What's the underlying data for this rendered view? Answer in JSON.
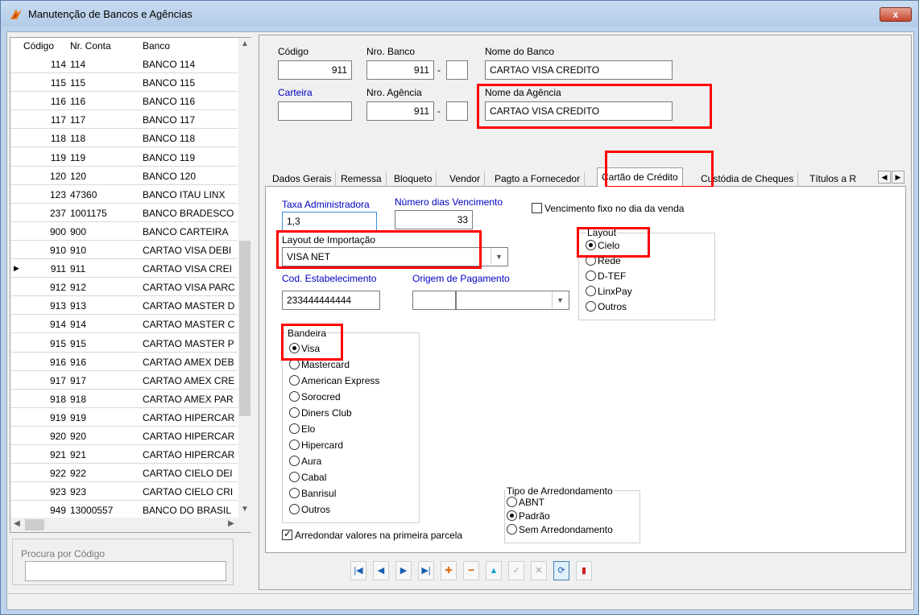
{
  "window": {
    "title": "Manutenção de Bancos e Agências",
    "close_label": "x"
  },
  "grid": {
    "headers": [
      "Código",
      "Nr. Conta",
      "Banco"
    ],
    "current_marker": "▶",
    "rows": [
      {
        "codigo": "114",
        "conta": "114",
        "banco": "BANCO 114"
      },
      {
        "codigo": "115",
        "conta": "115",
        "banco": "BANCO 115"
      },
      {
        "codigo": "116",
        "conta": "116",
        "banco": "BANCO 116"
      },
      {
        "codigo": "117",
        "conta": "117",
        "banco": "BANCO 117"
      },
      {
        "codigo": "118",
        "conta": "118",
        "banco": "BANCO 118"
      },
      {
        "codigo": "119",
        "conta": "119",
        "banco": "BANCO 119"
      },
      {
        "codigo": "120",
        "conta": "120",
        "banco": "BANCO 120"
      },
      {
        "codigo": "123",
        "conta": "47360",
        "banco": "BANCO ITAU LINX"
      },
      {
        "codigo": "237",
        "conta": "1001175",
        "banco": "BANCO BRADESCO"
      },
      {
        "codigo": "900",
        "conta": "900",
        "banco": "BANCO CARTEIRA"
      },
      {
        "codigo": "910",
        "conta": "910",
        "banco": "CARTAO VISA DEBI"
      },
      {
        "codigo": "911",
        "conta": "911",
        "banco": "CARTAO VISA CREI"
      },
      {
        "codigo": "912",
        "conta": "912",
        "banco": "CARTAO VISA PARC"
      },
      {
        "codigo": "913",
        "conta": "913",
        "banco": "CARTAO MASTER D"
      },
      {
        "codigo": "914",
        "conta": "914",
        "banco": "CARTAO MASTER C"
      },
      {
        "codigo": "915",
        "conta": "915",
        "banco": "CARTAO MASTER P"
      },
      {
        "codigo": "916",
        "conta": "916",
        "banco": "CARTAO AMEX DEB"
      },
      {
        "codigo": "917",
        "conta": "917",
        "banco": "CARTAO AMEX CRE"
      },
      {
        "codigo": "918",
        "conta": "918",
        "banco": "CARTAO AMEX PAR"
      },
      {
        "codigo": "919",
        "conta": "919",
        "banco": "CARTAO HIPERCAR"
      },
      {
        "codigo": "920",
        "conta": "920",
        "banco": "CARTAO HIPERCAR"
      },
      {
        "codigo": "921",
        "conta": "921",
        "banco": "CARTAO HIPERCAR"
      },
      {
        "codigo": "922",
        "conta": "922",
        "banco": "CARTAO CIELO DEI"
      },
      {
        "codigo": "923",
        "conta": "923",
        "banco": "CARTAO CIELO CRI"
      },
      {
        "codigo": "949",
        "conta": "13000557",
        "banco": "BANCO DO BRASIL"
      }
    ]
  },
  "search": {
    "label": "Procura por Código",
    "value": ""
  },
  "form": {
    "codigo_label": "Código",
    "codigo_value": "911",
    "nro_banco_label": "Nro. Banco",
    "nro_banco_value": "911",
    "nro_banco_dv": "",
    "nome_banco_label": "Nome do Banco",
    "nome_banco_value": "CARTAO VISA CREDITO",
    "carteira_label": "Carteira",
    "carteira_value": "",
    "nro_agencia_label": "Nro. Agência",
    "nro_agencia_value": "911",
    "nro_agencia_dv": "",
    "nome_agencia_label": "Nome da Agência",
    "nome_agencia_value": "CARTAO VISA CREDITO",
    "dash": "-"
  },
  "tabs": [
    "Dados Gerais",
    "Remessa",
    "Bloqueto",
    "Vendor",
    "Pagto a Fornecedor",
    "Cartão de Crédito",
    "Custódia de Cheques",
    "Títulos a R"
  ],
  "active_tab": "Cartão de Crédito",
  "cartao": {
    "taxa_label": "Taxa Administradora",
    "taxa_value": "1,3",
    "dias_label": "Número dias Vencimento",
    "dias_value": "33",
    "venc_fixo_label": "Vencimento fixo no dia da venda",
    "venc_fixo_checked": false,
    "layout_importacao_label": "Layout de Importação",
    "layout_importacao_value": "VISA NET",
    "cod_estab_label": "Cod. Estabelecimento",
    "cod_estab_value": "233444444444",
    "origem_label": "Origem de Pagamento",
    "origem_value": "",
    "layout_group": {
      "title": "Layout",
      "options": [
        "Cielo",
        "Rede",
        "D-TEF",
        "LinxPay",
        "Outros"
      ],
      "selected": "Cielo"
    },
    "bandeira_group": {
      "title": "Bandeira",
      "options": [
        "Visa",
        "Mastercard",
        "American Express",
        "Sorocred",
        "Diners Club",
        "Elo",
        "Hipercard",
        "Aura",
        "Cabal",
        "Banrisul",
        "Outros"
      ],
      "selected": "Visa"
    },
    "arred_group": {
      "title": "Tipo de Arredondamento",
      "options": [
        "ABNT",
        "Padrão",
        "Sem Arredondamento"
      ],
      "selected": "Padrão"
    },
    "arred_primeira_label": "Arredondar valores na primeira parcela",
    "arred_primeira_checked": true
  },
  "navigator": [
    {
      "name": "first-record",
      "glyph": "|◀",
      "color": "#1a5fb4"
    },
    {
      "name": "prior-record",
      "glyph": "◀",
      "color": "#1a5fb4"
    },
    {
      "name": "next-record",
      "glyph": "▶",
      "color": "#1a5fb4"
    },
    {
      "name": "last-record",
      "glyph": "▶|",
      "color": "#1a5fb4"
    },
    {
      "name": "insert-record",
      "glyph": "✚",
      "color": "#e0701a"
    },
    {
      "name": "delete-record",
      "glyph": "━",
      "color": "#e0701a"
    },
    {
      "name": "edit-record",
      "glyph": "▲",
      "color": "#1aa3c8"
    },
    {
      "name": "post-record",
      "glyph": "✓",
      "color": "#a0a0a0"
    },
    {
      "name": "cancel-record",
      "glyph": "✕",
      "color": "#a0a0a0"
    },
    {
      "name": "refresh-record",
      "glyph": "⟳",
      "color": "#1a5fb4"
    },
    {
      "name": "exit-door",
      "glyph": "▮",
      "color": "#d02020"
    }
  ],
  "colors": {
    "highlight_box": "#ff0000",
    "blue_label": "#0000c0"
  }
}
